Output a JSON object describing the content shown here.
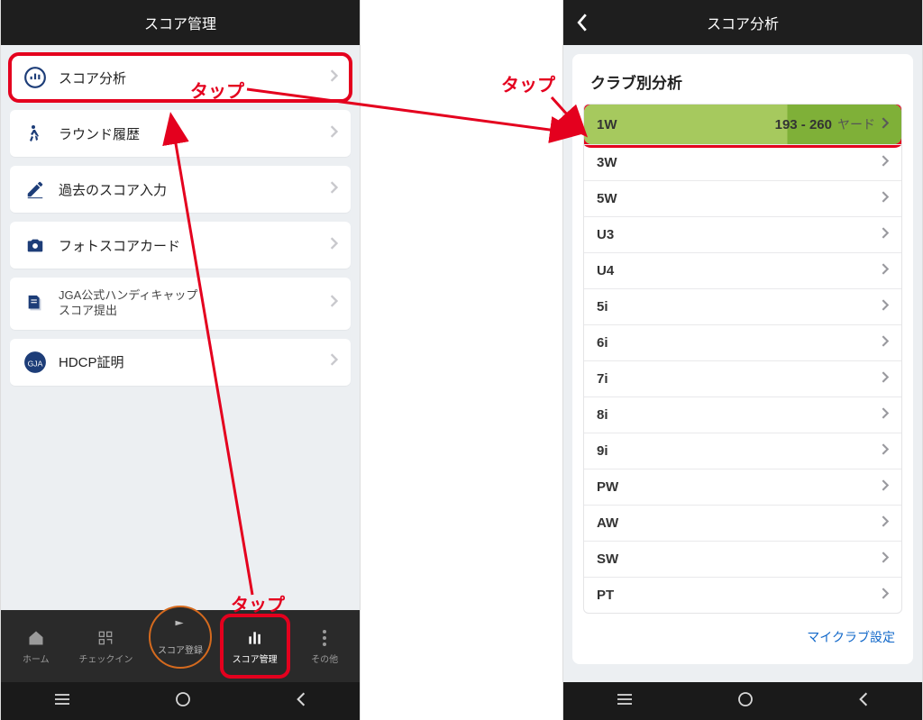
{
  "left": {
    "title": "スコア管理",
    "menu": [
      {
        "label": "スコア分析"
      },
      {
        "label": "ラウンド履歴"
      },
      {
        "label": "過去のスコア入力"
      },
      {
        "label": "フォトスコアカード"
      },
      {
        "label": "JGA公式ハンディキャップ\nスコア提出"
      },
      {
        "label": "HDCP証明"
      }
    ],
    "tabs": {
      "home": "ホーム",
      "checkin": "チェックイン",
      "center": "スコア登録",
      "manage": "スコア管理",
      "other": "その他"
    }
  },
  "right": {
    "title": "スコア分析",
    "section": "クラブ別分析",
    "clubs": [
      {
        "name": "1W",
        "range": "193 - 260",
        "unit": "ヤード",
        "first": true
      },
      {
        "name": "3W"
      },
      {
        "name": "5W"
      },
      {
        "name": "U3"
      },
      {
        "name": "U4"
      },
      {
        "name": "5i"
      },
      {
        "name": "6i"
      },
      {
        "name": "7i"
      },
      {
        "name": "8i"
      },
      {
        "name": "9i"
      },
      {
        "name": "PW"
      },
      {
        "name": "AW"
      },
      {
        "name": "SW"
      },
      {
        "name": "PT"
      }
    ],
    "link": "マイクラブ設定"
  },
  "annotations": {
    "tap": "タップ"
  }
}
